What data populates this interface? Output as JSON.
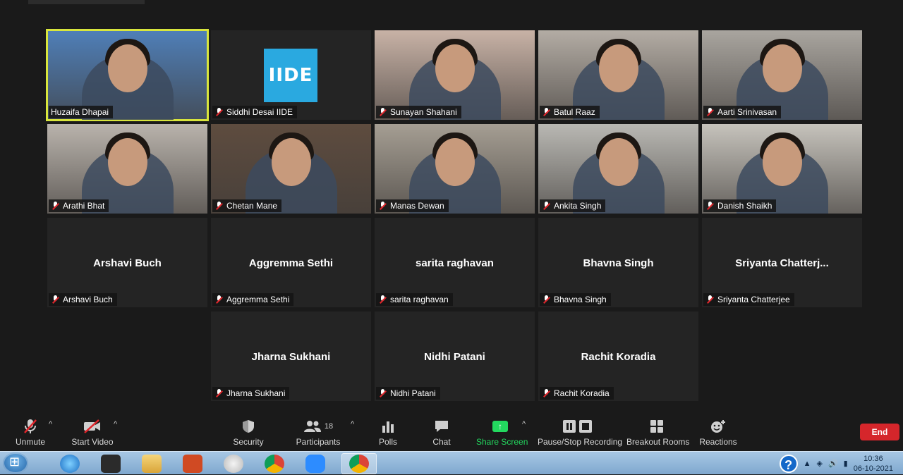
{
  "participants": [
    {
      "name": "Huzaifa Dhapai",
      "video": true,
      "active": true,
      "bg": "#4f7fb8"
    },
    {
      "name": "Siddhi Desai IIDE",
      "video": false,
      "logo": "IIDE"
    },
    {
      "name": "Sunayan Shahani",
      "video": true,
      "bg": "#c8b2a6"
    },
    {
      "name": "Batul Raaz",
      "video": true,
      "bg": "#b3aca4"
    },
    {
      "name": "Aarti Srinivasan",
      "video": true,
      "bg": "#a9a59f"
    },
    {
      "name": "Arathi Bhat",
      "video": true,
      "bg": "#b9b3ac"
    },
    {
      "name": "Chetan Mane",
      "video": true,
      "bg": "#5e4c3f"
    },
    {
      "name": "Manas Dewan",
      "video": true,
      "bg": "#a59e93"
    },
    {
      "name": "Ankita Singh",
      "video": true,
      "bg": "#b9b8b3"
    },
    {
      "name": "Danish Shaikh",
      "video": true,
      "bg": "#c6c3bc"
    },
    {
      "name": "Arshavi Buch",
      "video": false,
      "display": "Arshavi Buch"
    },
    {
      "name": "Aggremma Sethi",
      "video": false,
      "display": "Aggremma Sethi"
    },
    {
      "name": "sarita raghavan",
      "video": false,
      "display": "sarita raghavan"
    },
    {
      "name": "Bhavna Singh",
      "video": false,
      "display": "Bhavna Singh"
    },
    {
      "name": "Sriyanta Chatterjee",
      "video": false,
      "display": "Sriyanta  Chatterj..."
    },
    {
      "name": "Jharna Sukhani",
      "video": false,
      "display": "Jharna Sukhani"
    },
    {
      "name": "Nidhi Patani",
      "video": false,
      "display": "Nidhi Patani"
    },
    {
      "name": "Rachit Koradia",
      "video": false,
      "display": "Rachit Koradia"
    }
  ],
  "toolbar": {
    "unmute": "Unmute",
    "start_video": "Start Video",
    "security": "Security",
    "participants": "Participants",
    "participants_count": "18",
    "polls": "Polls",
    "chat": "Chat",
    "share_screen": "Share Screen",
    "pause_recording": "Pause/Stop Recording",
    "breakout_rooms": "Breakout Rooms",
    "reactions": "Reactions",
    "end": "End"
  },
  "colors": {
    "active_border": "#d8e53d",
    "share_green": "#23d95f",
    "end_red": "#d5262b",
    "mic_muted": "#e0252b"
  },
  "taskbar": {
    "apps": [
      "ie-icon",
      "media-icon",
      "explorer-icon",
      "powerpoint-icon",
      "paint-icon",
      "chrome-icon",
      "zoom-icon",
      "chrome-profile-icon"
    ],
    "time": "10:36",
    "date": "06-10-2021"
  }
}
